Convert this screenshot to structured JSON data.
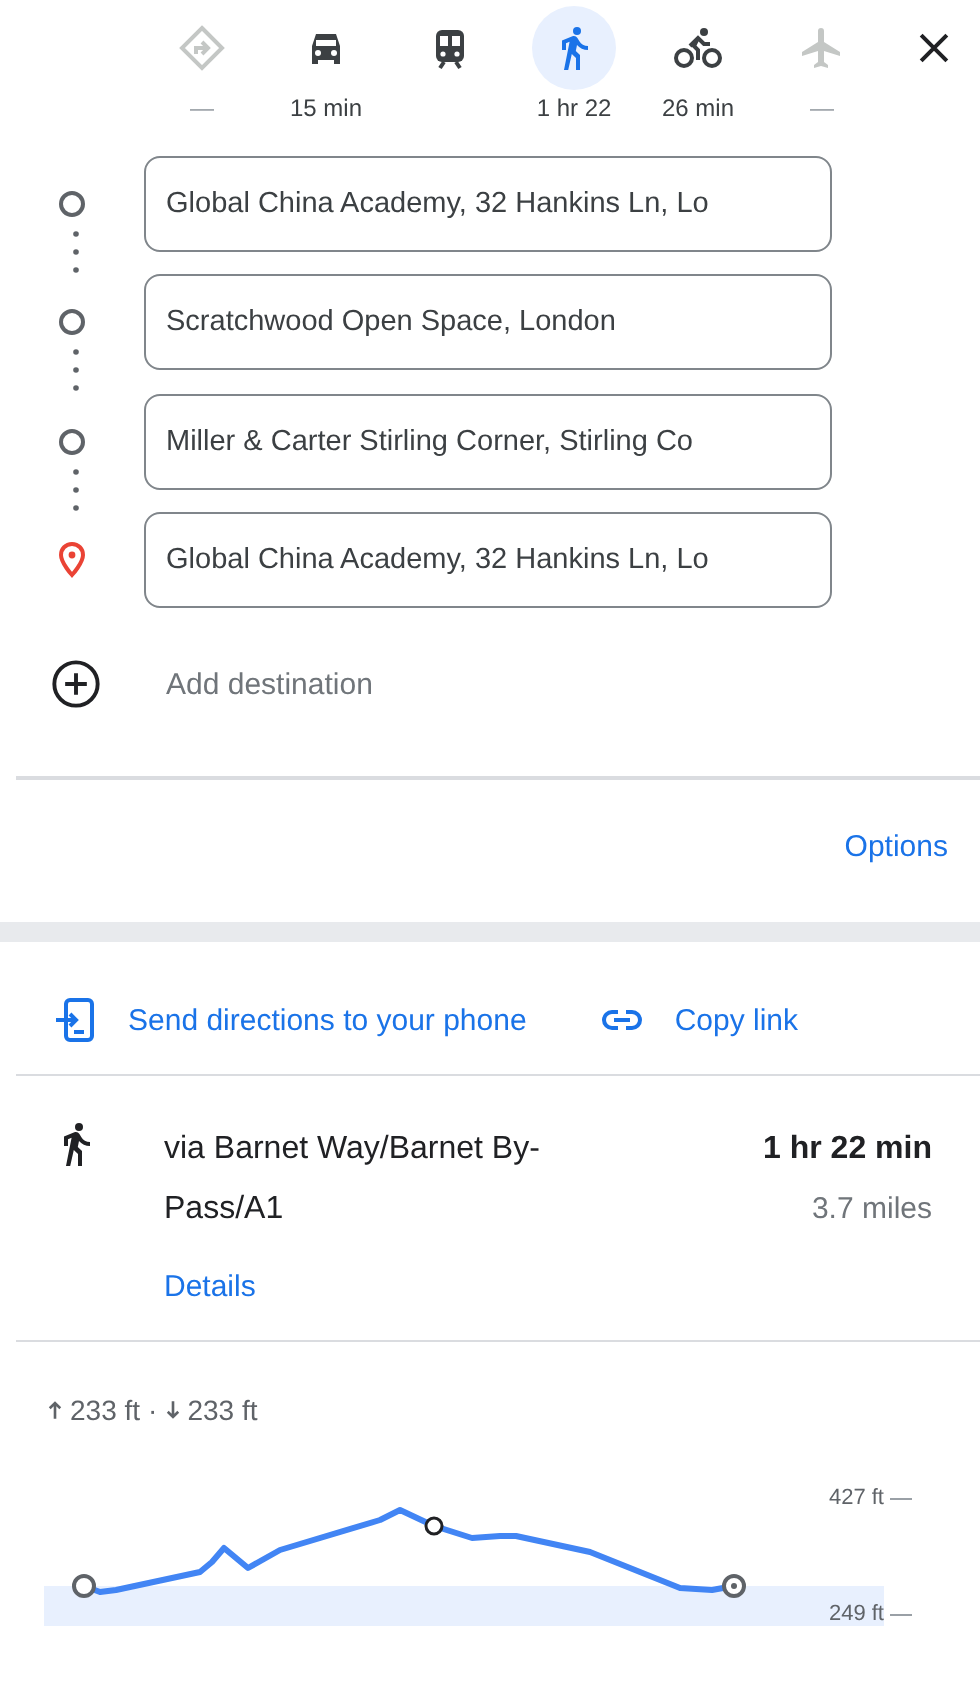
{
  "travel_modes": [
    {
      "kind": "best",
      "label": "—",
      "selected": false,
      "disabled": true
    },
    {
      "kind": "car",
      "label": "15 min",
      "selected": false,
      "disabled": false
    },
    {
      "kind": "transit",
      "selected": false,
      "disabled": false
    },
    {
      "kind": "walk",
      "label": "1 hr 22",
      "selected": true,
      "disabled": false
    },
    {
      "kind": "bike",
      "label": "26 min",
      "selected": false,
      "disabled": false
    },
    {
      "kind": "flight",
      "label": "—",
      "selected": false,
      "disabled": true
    }
  ],
  "waypoints": [
    {
      "kind": "stop",
      "value": "Global China Academy, 32 Hankins Ln, Lo"
    },
    {
      "kind": "stop",
      "value": "Scratchwood Open Space, London"
    },
    {
      "kind": "stop",
      "value": "Miller & Carter Stirling Corner, Stirling Co"
    },
    {
      "kind": "destination",
      "value": "Global China Academy, 32 Hankins Ln, Lo"
    }
  ],
  "add_destination": {
    "label": "Add destination"
  },
  "options_link": "Options",
  "share": {
    "send": "Send directions to your phone",
    "copy": "Copy link"
  },
  "route": {
    "via": "via Barnet Way/Barnet By-Pass/A1",
    "duration": "1 hr 22 min",
    "distance": "3.7 miles",
    "details": "Details"
  },
  "elevation": {
    "gain": "233 ft",
    "loss": "233 ft",
    "separator": "·",
    "max_label": "427 ft",
    "min_label": "249 ft"
  }
}
